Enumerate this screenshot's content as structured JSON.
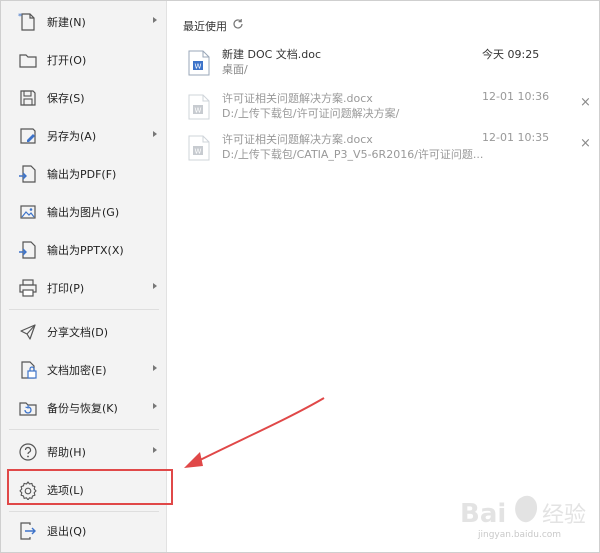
{
  "menu": {
    "items": [
      {
        "label": "新建(N)",
        "icon": "new-file-icon",
        "submenu": true
      },
      {
        "label": "打开(O)",
        "icon": "folder-open-icon",
        "submenu": false
      },
      {
        "label": "保存(S)",
        "icon": "save-icon",
        "submenu": false
      },
      {
        "label": "另存为(A)",
        "icon": "save-as-icon",
        "submenu": true
      },
      {
        "label": "输出为PDF(F)",
        "icon": "export-pdf-icon",
        "submenu": false
      },
      {
        "label": "输出为图片(G)",
        "icon": "export-image-icon",
        "submenu": false
      },
      {
        "label": "输出为PPTX(X)",
        "icon": "export-pptx-icon",
        "submenu": false
      },
      {
        "label": "打印(P)",
        "icon": "print-icon",
        "submenu": true
      },
      {
        "label": "分享文档(D)",
        "icon": "share-icon",
        "submenu": false
      },
      {
        "label": "文档加密(E)",
        "icon": "encrypt-icon",
        "submenu": true
      },
      {
        "label": "备份与恢复(K)",
        "icon": "backup-icon",
        "submenu": true
      },
      {
        "label": "帮助(H)",
        "icon": "help-icon",
        "submenu": true
      },
      {
        "label": "选项(L)",
        "icon": "gear-icon",
        "submenu": false
      },
      {
        "label": "退出(Q)",
        "icon": "exit-icon",
        "submenu": false
      }
    ]
  },
  "recent": {
    "title": "最近使用",
    "documents": [
      {
        "name": "新建 DOC 文档.doc",
        "path": "桌面/",
        "time": "今天 09:25"
      },
      {
        "name": "许可证相关问题解决方案.docx",
        "path": "D:/上传下载包/许可证问题解决方案/",
        "time": "12-01 10:36"
      },
      {
        "name": "许可证相关问题解决方案.docx",
        "path": "D:/上传下载包/CATIA_P3_V5-6R2016/许可证问题...",
        "time": "12-01 10:35"
      }
    ],
    "close_glyph": "×"
  },
  "watermark": {
    "text": "jingyan.baidu.com"
  },
  "colors": {
    "highlight": "#e04848",
    "sidebar_bg": "#f3f3f3",
    "icon_blue": "#3d73c9"
  }
}
